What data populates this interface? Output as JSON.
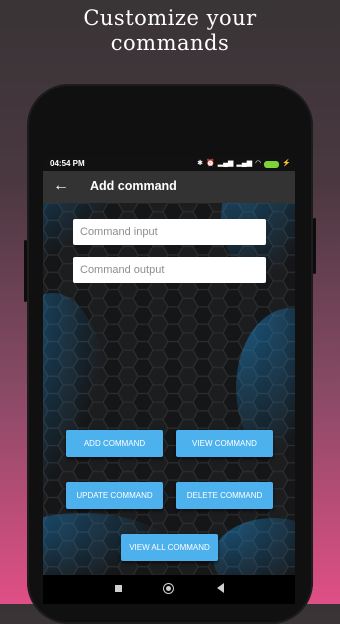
{
  "headline": {
    "line1": "Customize your",
    "line2": "commands"
  },
  "statusbar": {
    "time": "04:54 PM",
    "battery_level": ""
  },
  "appbar": {
    "back_icon": "arrow-left-icon",
    "title": "Add command"
  },
  "form": {
    "command_input_placeholder": "Command input",
    "command_output_placeholder": "Command output"
  },
  "buttons": {
    "add": "ADD COMMAND",
    "view": "VIEW COMMAND",
    "update": "UPDATE COMMAND",
    "delete": "DELETE COMMAND",
    "view_all": "VIEW ALL COMMAND"
  },
  "colors": {
    "button": "#4db1ee",
    "appbar": "#333333",
    "hex_glow": "#1e8fd8"
  }
}
